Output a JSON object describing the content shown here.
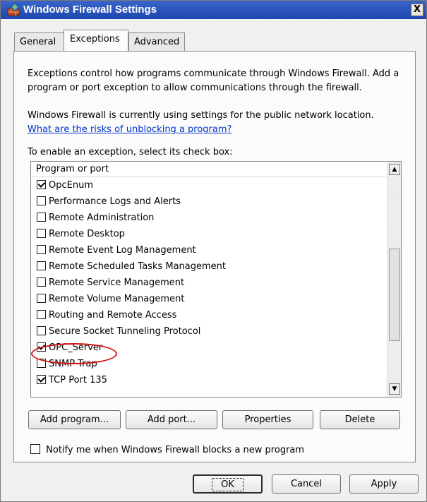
{
  "window": {
    "title": "Windows Firewall Settings",
    "close_label": "X"
  },
  "tabs": [
    {
      "label": "General",
      "active": false
    },
    {
      "label": "Exceptions",
      "active": true
    },
    {
      "label": "Advanced",
      "active": false
    }
  ],
  "content": {
    "intro_line1": "Exceptions control how programs communicate through Windows Firewall. Add a",
    "intro_line2": "program or port exception to allow communications through the firewall.",
    "status_text": "Windows Firewall is currently using settings for the public network location.",
    "risk_link": "What are the risks of unblocking a program?",
    "select_label": "To enable an exception, select its check box:"
  },
  "list": {
    "header": "Program or port",
    "items": [
      {
        "label": "OpcEnum",
        "checked": true
      },
      {
        "label": "Performance Logs and Alerts",
        "checked": false
      },
      {
        "label": "Remote Administration",
        "checked": false
      },
      {
        "label": "Remote Desktop",
        "checked": false
      },
      {
        "label": "Remote Event Log Management",
        "checked": false
      },
      {
        "label": "Remote Scheduled Tasks Management",
        "checked": false
      },
      {
        "label": "Remote Service Management",
        "checked": false
      },
      {
        "label": "Remote Volume Management",
        "checked": false
      },
      {
        "label": "Routing and Remote Access",
        "checked": false
      },
      {
        "label": "Secure Socket Tunneling Protocol",
        "checked": false
      },
      {
        "label": "OPC_Server",
        "checked": true
      },
      {
        "label": "SNMP Trap",
        "checked": false
      },
      {
        "label": "TCP Port 135",
        "checked": true
      }
    ]
  },
  "buttons": {
    "add_program": "Add program...",
    "add_port": "Add port...",
    "properties": "Properties",
    "delete": "Delete"
  },
  "notify": {
    "label": "Notify me when Windows Firewall blocks a new program",
    "checked": false
  },
  "footer": {
    "ok": "OK",
    "cancel": "Cancel",
    "apply": "Apply"
  },
  "colors": {
    "titlebar": "#1c47b0",
    "link": "#0033cc",
    "highlight_ring": "#d21414"
  }
}
